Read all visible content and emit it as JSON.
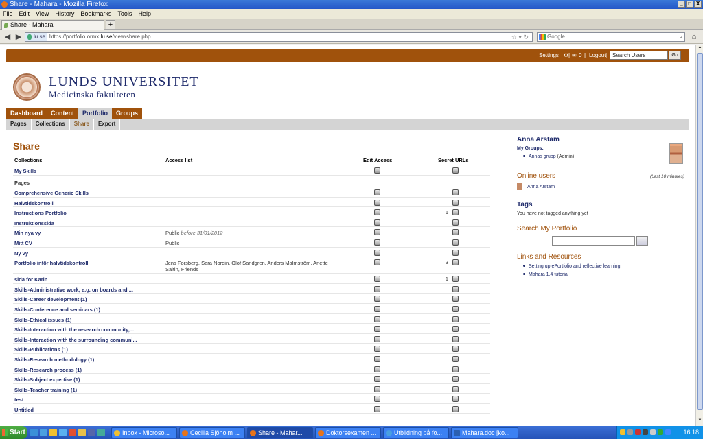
{
  "window": {
    "title": "Share - Mahara - Mozilla Firefox"
  },
  "menu": [
    "File",
    "Edit",
    "View",
    "History",
    "Bookmarks",
    "Tools",
    "Help"
  ],
  "tab": {
    "label": "Share - Mahara",
    "new_tab": "+"
  },
  "nav": {
    "site_badge": "lu.se",
    "url_prefix": "https://portfolio.ormx.",
    "url_host": "lu.se",
    "url_suffix": "/view/share.php",
    "search_placeholder": "Google"
  },
  "topbar": {
    "settings": "Settings",
    "messages_count": "0",
    "logout": "Logout",
    "search_users_placeholder": "Search Users",
    "go": "Go"
  },
  "brand": {
    "university": "LUNDS UNIVERSITET",
    "faculty": "Medicinska fakulteten"
  },
  "main_tabs": [
    {
      "label": "Dashboard",
      "selected": false
    },
    {
      "label": "Content",
      "selected": false
    },
    {
      "label": "Portfolio",
      "selected": true
    },
    {
      "label": "Groups",
      "selected": false
    }
  ],
  "sub_tabs": [
    {
      "label": "Pages",
      "selected": false
    },
    {
      "label": "Collections",
      "selected": false
    },
    {
      "label": "Share",
      "selected": true
    },
    {
      "label": "Export",
      "selected": false
    }
  ],
  "page_title": "Share",
  "table": {
    "headers": {
      "name": "Collections",
      "access": "Access list",
      "edit": "Edit Access",
      "secret": "Secret URLs"
    },
    "collections": [
      {
        "name": "My Skills",
        "access": "",
        "access_date": "",
        "secret_count": ""
      }
    ],
    "pages_label": "Pages",
    "pages": [
      {
        "name": "Comprehensive Generic Skills",
        "access": "",
        "access_date": "",
        "secret_count": ""
      },
      {
        "name": "Halvtidskontroll",
        "access": "",
        "access_date": "",
        "secret_count": ""
      },
      {
        "name": "Instructions Portfolio",
        "access": "",
        "access_date": "",
        "secret_count": "1"
      },
      {
        "name": "Instruktionssida",
        "access": "",
        "access_date": "",
        "secret_count": ""
      },
      {
        "name": "Min nya vy",
        "access": "Public",
        "access_date": "before 31/01/2012",
        "secret_count": ""
      },
      {
        "name": "Mitt CV",
        "access": "Public",
        "access_date": "",
        "secret_count": ""
      },
      {
        "name": "Ny vy",
        "access": "",
        "access_date": "",
        "secret_count": ""
      },
      {
        "name": "Portfolio inför halvtidskontroll",
        "access": "Jens Forsberg, Sara Nordin, Olof Sandgren, Anders Malmström, Anette Saltin, Friends",
        "access_date": "",
        "secret_count": "3"
      },
      {
        "name": "sida för Karin",
        "access": "",
        "access_date": "",
        "secret_count": "1"
      },
      {
        "name": "Skills-Administrative work, e.g. on boards and ...",
        "access": "",
        "access_date": "",
        "secret_count": ""
      },
      {
        "name": "Skills-Career development (1)",
        "access": "",
        "access_date": "",
        "secret_count": ""
      },
      {
        "name": "Skills-Conference and seminars (1)",
        "access": "",
        "access_date": "",
        "secret_count": ""
      },
      {
        "name": "Skills-Ethical issues (1)",
        "access": "",
        "access_date": "",
        "secret_count": ""
      },
      {
        "name": "Skills-Interaction with the research community,...",
        "access": "",
        "access_date": "",
        "secret_count": ""
      },
      {
        "name": "Skills-Interaction with the surrounding communi...",
        "access": "",
        "access_date": "",
        "secret_count": ""
      },
      {
        "name": "Skills-Publications (1)",
        "access": "",
        "access_date": "",
        "secret_count": ""
      },
      {
        "name": "Skills-Research methodology (1)",
        "access": "",
        "access_date": "",
        "secret_count": ""
      },
      {
        "name": "Skills-Research process (1)",
        "access": "",
        "access_date": "",
        "secret_count": ""
      },
      {
        "name": "Skills-Subject expertise (1)",
        "access": "",
        "access_date": "",
        "secret_count": ""
      },
      {
        "name": "Skills-Teacher training (1)",
        "access": "",
        "access_date": "",
        "secret_count": ""
      },
      {
        "name": "test",
        "access": "",
        "access_date": "",
        "secret_count": ""
      },
      {
        "name": "Untitled",
        "access": "",
        "access_date": "",
        "secret_count": ""
      }
    ]
  },
  "sidebar": {
    "user_name": "Anna Arstam",
    "my_groups_label": "My Groups:",
    "group_name": "Annas grupp",
    "group_role": "(Admin)",
    "online_title": "Online users",
    "online_note": "(Last 10 minutes)",
    "online_user": "Anna Arstam",
    "tags_title": "Tags",
    "tags_text": "You have not tagged anything yet",
    "search_title": "Search My Portfolio",
    "links_title": "Links and Resources",
    "links": [
      "Setting up ePortfolio and reflective learning",
      "Mahara 1.4 tutorial"
    ]
  },
  "taskbar": {
    "start": "Start",
    "tasks": [
      {
        "label": "Inbox - Microso...",
        "active": false
      },
      {
        "label": "Cecilia Sjöholm ...",
        "active": false
      },
      {
        "label": "Share - Mahar...",
        "active": true
      },
      {
        "label": "Doktorsexamen ...",
        "active": false
      },
      {
        "label": "Utbildning på fo...",
        "active": false
      },
      {
        "label": "Mahara.doc [ko...",
        "active": false
      }
    ],
    "clock": "16:18"
  },
  "colors": {
    "brand": "#a0520c",
    "link": "#1f2b6b",
    "nav_gray": "#d4d4d4"
  }
}
